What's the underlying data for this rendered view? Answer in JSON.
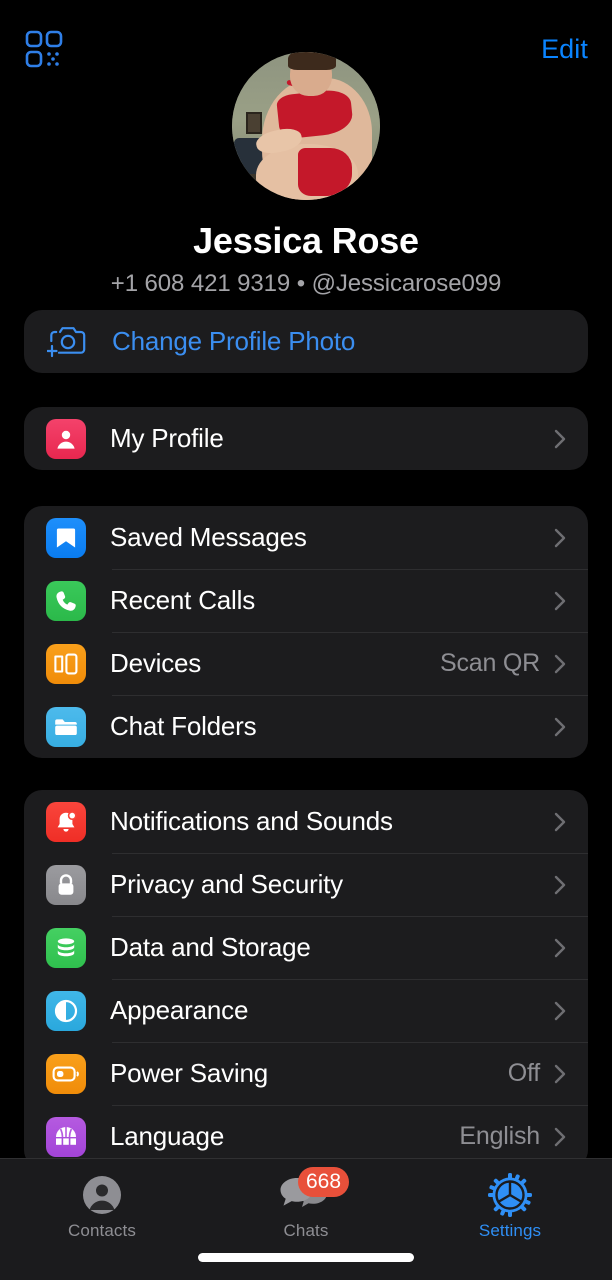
{
  "topbar": {
    "qr_icon": "qr-code-icon",
    "edit_label": "Edit"
  },
  "profile": {
    "name": "Jessica Rose",
    "subtitle": "+1 608 421 9319 • @Jessicarose099",
    "phone": "+1 608 421 9319",
    "username": "@Jessicarose099",
    "avatar_alt": "profile-photo"
  },
  "change_photo": {
    "label": "Change Profile Photo",
    "icon": "camera-plus-icon",
    "color": "#3b8ef0"
  },
  "groups": [
    {
      "id": "profile-group",
      "rows": [
        {
          "id": "my-profile",
          "label": "My Profile",
          "value": "",
          "icon": "person-circle-icon",
          "icon_color": "#f4426b"
        }
      ]
    },
    {
      "id": "main-group",
      "rows": [
        {
          "id": "saved-messages",
          "label": "Saved Messages",
          "value": "",
          "icon": "bookmark-icon",
          "icon_color": "#1e8ffb"
        },
        {
          "id": "recent-calls",
          "label": "Recent Calls",
          "value": "",
          "icon": "phone-icon",
          "icon_color": "#3ac95a"
        },
        {
          "id": "devices",
          "label": "Devices",
          "value": "Scan QR",
          "icon": "devices-icon",
          "icon_color": "#f9a01b"
        },
        {
          "id": "chat-folders",
          "label": "Chat Folders",
          "value": "",
          "icon": "folder-icon",
          "icon_color": "#4dbaec"
        }
      ]
    },
    {
      "id": "settings-group",
      "rows": [
        {
          "id": "notifications-and-sounds",
          "label": "Notifications and Sounds",
          "value": "",
          "icon": "bell-icon",
          "icon_color": "#f9453c"
        },
        {
          "id": "privacy-and-security",
          "label": "Privacy and Security",
          "value": "",
          "icon": "lock-icon",
          "icon_color": "#9b9b9f"
        },
        {
          "id": "data-and-storage",
          "label": "Data and Storage",
          "value": "",
          "icon": "database-icon",
          "icon_color": "#45d062"
        },
        {
          "id": "appearance",
          "label": "Appearance",
          "value": "",
          "icon": "contrast-circle-icon",
          "icon_color": "#40b7e8"
        },
        {
          "id": "power-saving",
          "label": "Power Saving",
          "value": "Off",
          "icon": "battery-icon",
          "icon_color": "#f9a01b"
        },
        {
          "id": "language",
          "label": "Language",
          "value": "English",
          "icon": "globe-icon",
          "icon_color": "#b55ae0"
        }
      ]
    }
  ],
  "tabbar": {
    "tabs": [
      {
        "id": "contacts",
        "label": "Contacts",
        "icon": "person-icon",
        "badge": "",
        "active": false
      },
      {
        "id": "chats",
        "label": "Chats",
        "icon": "chat-bubbles-icon",
        "badge": "668",
        "active": false
      },
      {
        "id": "settings",
        "label": "Settings",
        "icon": "gear-icon",
        "badge": "",
        "active": true
      }
    ]
  },
  "colors": {
    "accent": "#0a84ff",
    "background": "#000000",
    "card": "#1c1c1e",
    "separator": "#2e2e30",
    "secondary_text": "#8e8e93",
    "badge_red": "#e8503a"
  }
}
